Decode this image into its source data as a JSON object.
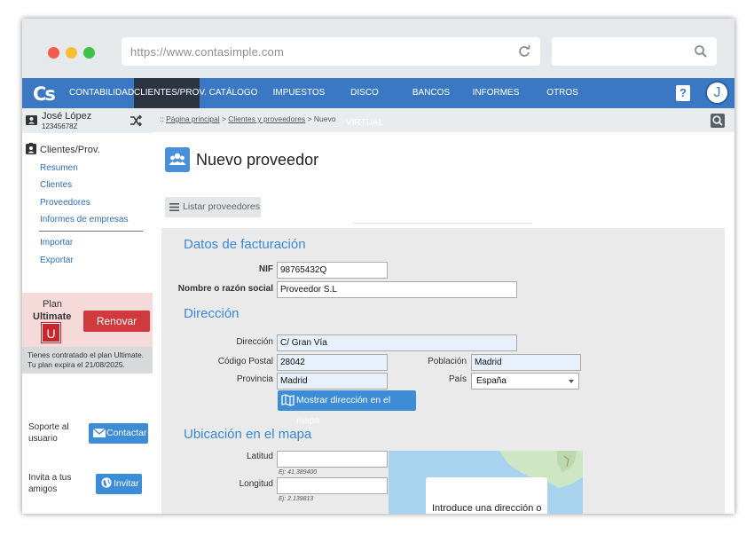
{
  "browser": {
    "url": "https://www.contasimple.com"
  },
  "nav": {
    "logo": "Cs",
    "items": [
      {
        "label": "CONTABILIDAD",
        "active": false
      },
      {
        "label": "CLIENTES/PROV.",
        "active": true
      },
      {
        "label": "CATÁLOGO",
        "active": false
      },
      {
        "label": "IMPUESTOS",
        "active": false
      },
      {
        "label": "DISCO VIRTUAL",
        "active": false
      },
      {
        "label": "BANCOS",
        "active": false
      },
      {
        "label": "INFORMES",
        "active": false
      },
      {
        "label": "OTROS",
        "active": false
      }
    ],
    "help": "?",
    "avatar": "J"
  },
  "sidebar": {
    "user_name": "José López",
    "user_id": "12345678Z",
    "section_title": "Clientes/Prov.",
    "links": [
      "Resumen",
      "Clientes",
      "Proveedores",
      "Informes de empresas"
    ],
    "links2": [
      "Importar",
      "Exportar"
    ],
    "plan_label": "Plan",
    "plan_name": "Ultimate",
    "plan_badge": "U",
    "renew_label": "Renovar",
    "plan_note": "Tienes contratado el plan Ultimate. Tu plan expira el 21/08/2025.",
    "support_text": "Soporte al usuario",
    "contact_label": "Contactar",
    "invite_text": "Invita a tus amigos",
    "invite_label": "Invitar"
  },
  "breadcrumb": {
    "prefix": ":: ",
    "home": "Página principal",
    "sep": " > ",
    "section": "Clientes y proveedores",
    "current": "Nuevo"
  },
  "main": {
    "title": "Nuevo proveedor",
    "list_button": "Listar proveedores",
    "billing": {
      "heading": "Datos de facturación",
      "nif_label": "NIF",
      "nif_value": "98765432Q",
      "name_label": "Nombre o razón social",
      "name_value": "Proveedor S.L"
    },
    "address": {
      "heading": "Dirección",
      "street_label": "Dirección",
      "street_value": "C/ Gran Vía",
      "zip_label": "Código Postal",
      "zip_value": "28042",
      "city_label": "Población",
      "city_value": "Madrid",
      "province_label": "Provincia",
      "province_value": "Madrid",
      "country_label": "País",
      "country_value": "España",
      "map_button": "Mostrar dirección en el mapa"
    },
    "location": {
      "heading": "Ubicación en el mapa",
      "lat_label": "Latitud",
      "lat_hint": "Ej: 41.389400",
      "lng_label": "Longitud",
      "lng_hint": "Ej: 2.139813",
      "map_popup": "Introduce una dirección o"
    }
  }
}
